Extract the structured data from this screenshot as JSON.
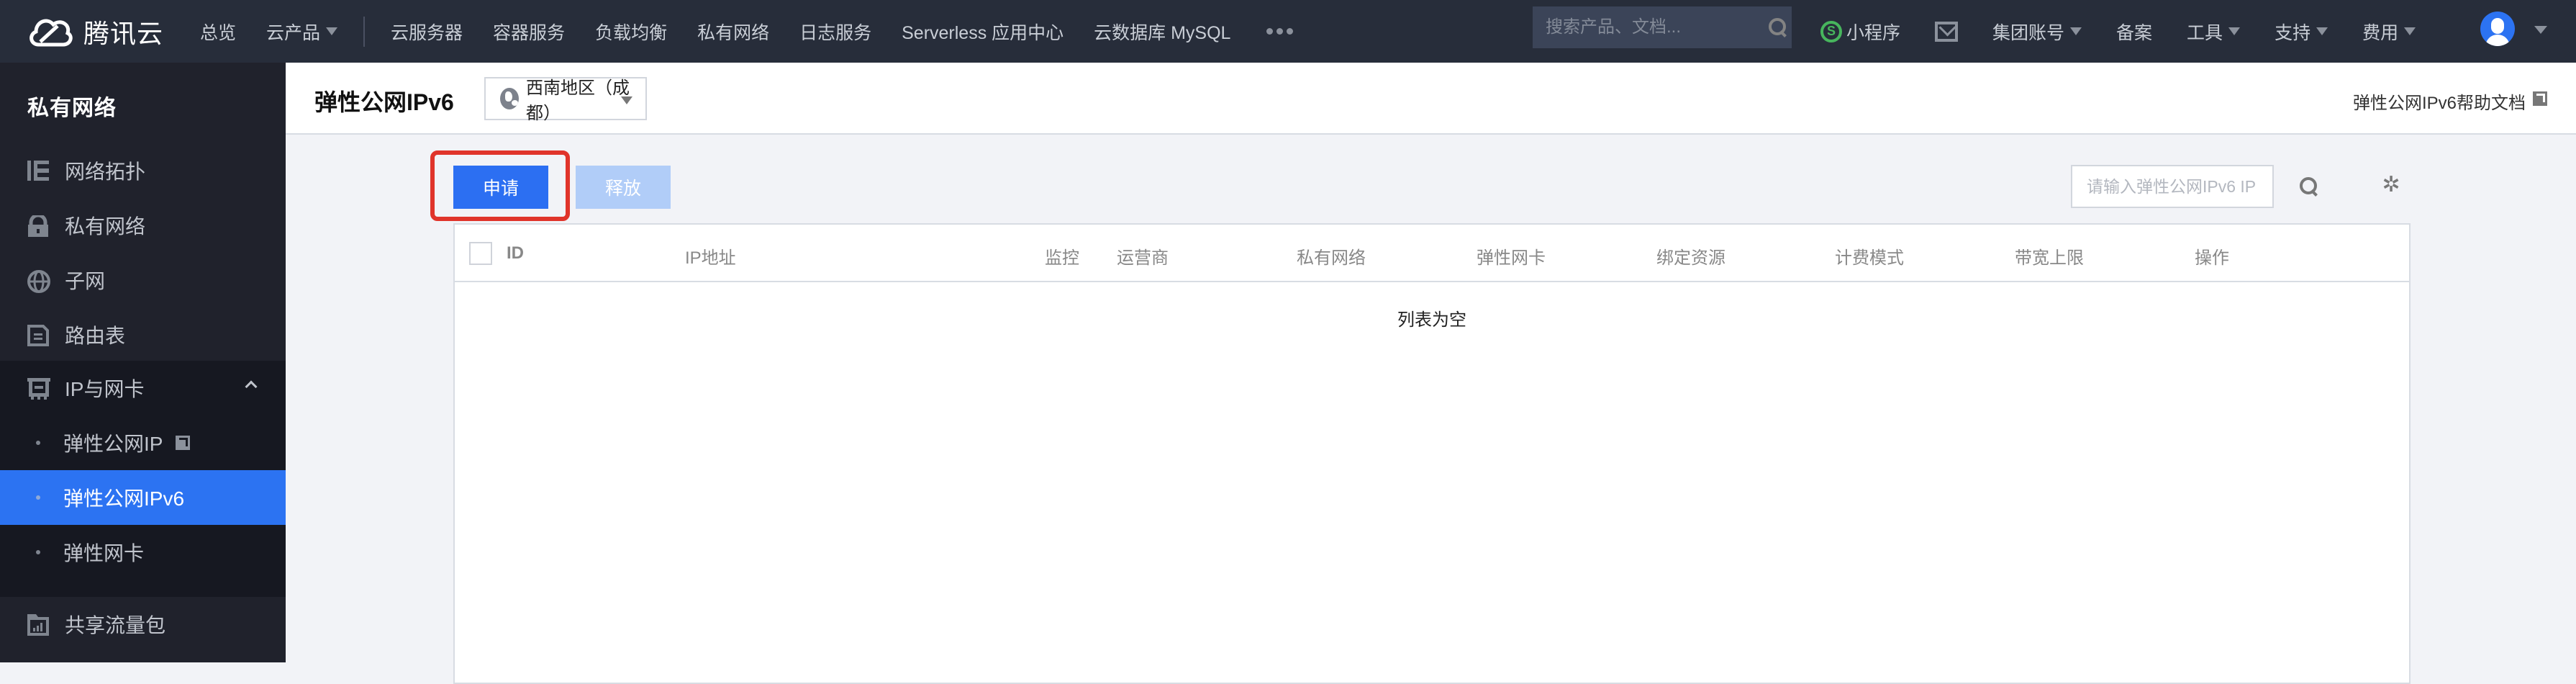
{
  "topnav": {
    "brand": "腾讯云",
    "items": [
      {
        "label": "总览"
      },
      {
        "label": "云产品",
        "dropdown": true
      },
      {
        "label": "云服务器"
      },
      {
        "label": "容器服务"
      },
      {
        "label": "负载均衡"
      },
      {
        "label": "私有网络"
      },
      {
        "label": "日志服务"
      },
      {
        "label": "Serverless 应用中心"
      },
      {
        "label": "云数据库 MySQL"
      }
    ],
    "more_icon": "more-dots-icon",
    "search_placeholder": "搜索产品、文档...",
    "right_items": [
      {
        "label": "小程序",
        "icon": "mini-program-icon"
      },
      {
        "label": "",
        "icon": "mail-icon"
      },
      {
        "label": "集团账号",
        "dropdown": true
      },
      {
        "label": "备案"
      },
      {
        "label": "工具",
        "dropdown": true
      },
      {
        "label": "支持",
        "dropdown": true
      },
      {
        "label": "费用",
        "dropdown": true
      }
    ]
  },
  "sidebar": {
    "title": "私有网络",
    "items": [
      {
        "label": "网络拓扑",
        "icon": "topology-icon"
      },
      {
        "label": "私有网络",
        "icon": "lock-icon"
      },
      {
        "label": "子网",
        "icon": "globe-icon"
      },
      {
        "label": "路由表",
        "icon": "document-icon"
      }
    ],
    "group": {
      "label": "IP与网卡",
      "icon": "network-card-icon",
      "expanded": true,
      "children": [
        {
          "label": "弹性公网IP",
          "external": true
        },
        {
          "label": "弹性公网IPv6",
          "active": true
        },
        {
          "label": "弹性网卡"
        }
      ]
    },
    "after_group": [
      {
        "label": "共享流量包",
        "icon": "traffic-package-icon"
      }
    ]
  },
  "page": {
    "title": "弹性公网IPv6",
    "region": "西南地区（成都）",
    "help_link": "弹性公网IPv6帮助文档"
  },
  "toolbar": {
    "apply_label": "申请",
    "release_label": "释放",
    "search_placeholder": "请输入弹性公网IPv6 IP"
  },
  "table": {
    "columns": [
      "ID",
      "IP地址",
      "监控",
      "运营商",
      "私有网络",
      "弹性网卡",
      "绑定资源",
      "计费模式",
      "带宽上限",
      "操作"
    ],
    "rows": [],
    "empty_text": "列表为空"
  },
  "colors": {
    "topnav_bg": "#272d3a",
    "sidebar_bg": "#20222c",
    "active_blue": "#2c73f2",
    "primary_button": "#2c6ff2",
    "disabled_button": "#b1cdf8",
    "highlight_red": "#e0342b"
  }
}
